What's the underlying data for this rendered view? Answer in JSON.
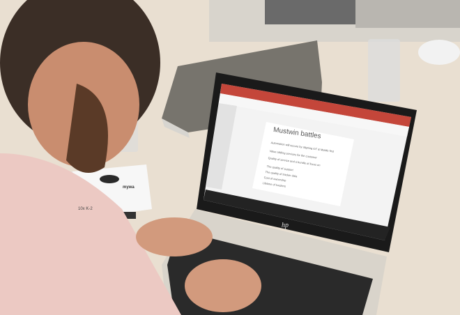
{
  "scene": {
    "description_free": true,
    "slide": {
      "title": "Mustwin battles",
      "bullets": [
        "Automation will secure by aligning IoT & Mobile first",
        "Value adding services for the customer",
        "Quality of service and a bundle of focus on",
        "The quality of support",
        "The quality of tracker data",
        "Cost of ownership",
        "Lifetime of trackers"
      ]
    },
    "product_box": {
      "brand": "mywa",
      "model": "10x K-2"
    },
    "laptop_logo": "hp"
  }
}
